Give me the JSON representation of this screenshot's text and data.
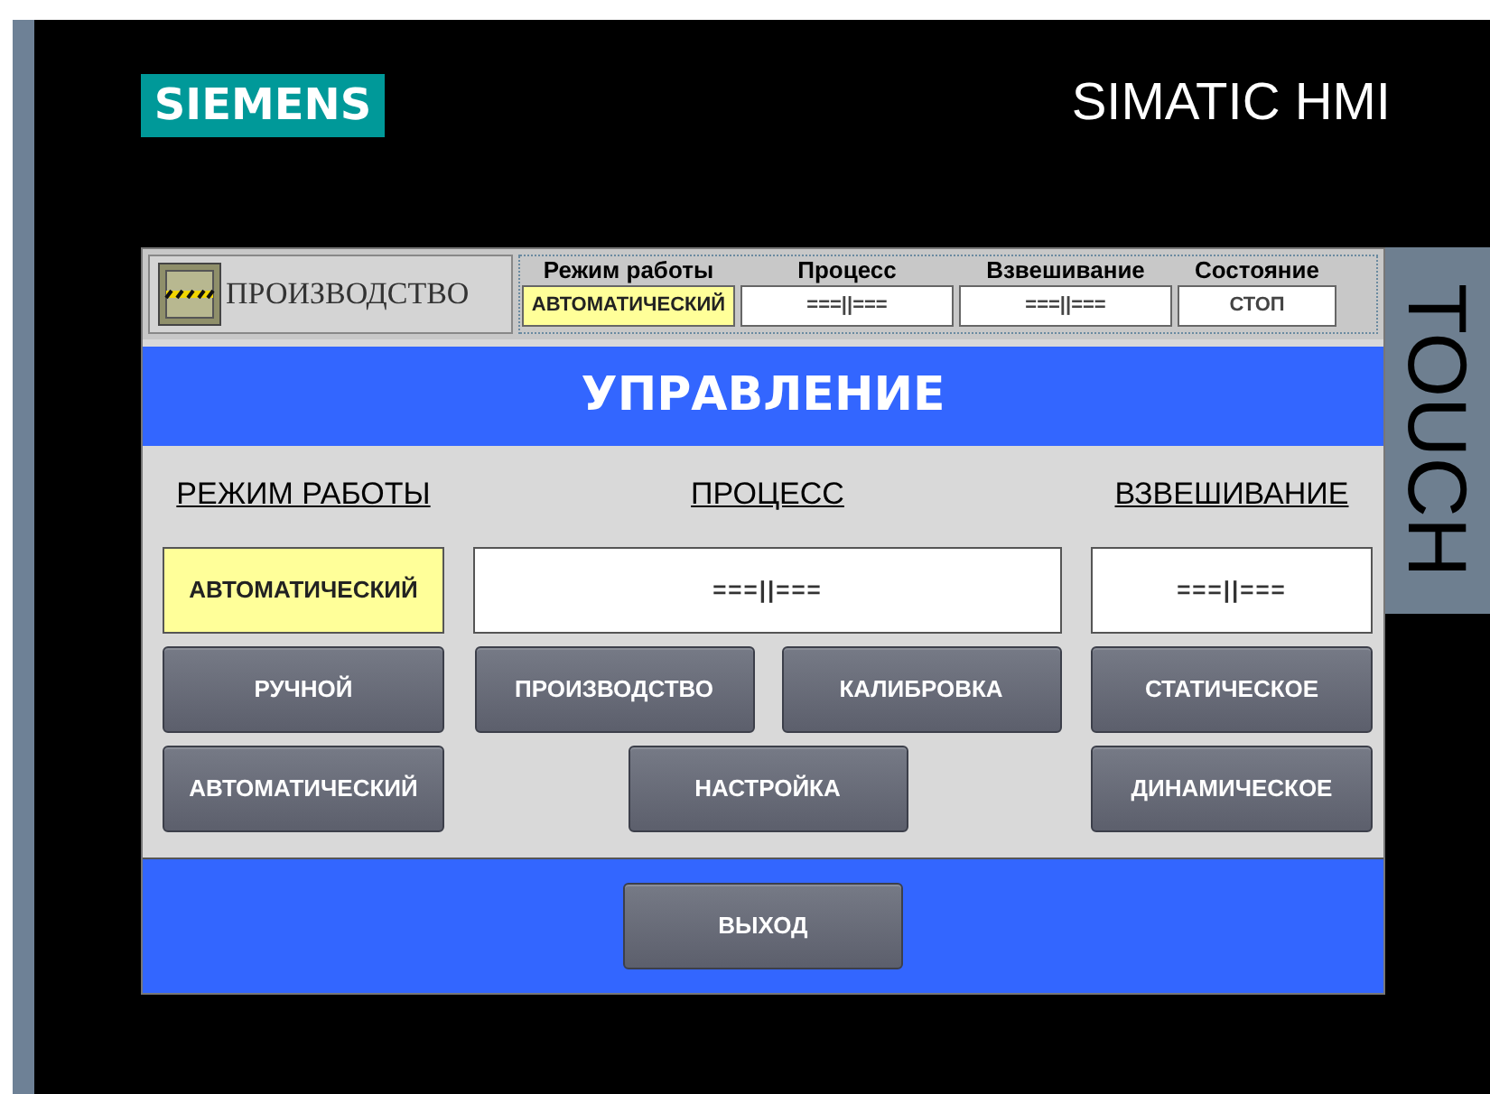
{
  "device": {
    "brand": "SIEMENS",
    "product": "SIMATIC HMI",
    "edge_label": "TOUCH"
  },
  "header": {
    "screen_name": "ПРОИЗВОДСТВО",
    "status": [
      {
        "label": "Режим работы",
        "value": "АВТОМАТИЧЕСКИЙ",
        "highlighted": true
      },
      {
        "label": "Процесс",
        "value": "===||===",
        "highlighted": false
      },
      {
        "label": "Взвешивание",
        "value": "===||===",
        "highlighted": false
      },
      {
        "label": "Состояние",
        "value": "СТОП",
        "highlighted": false
      }
    ]
  },
  "title": "УПРАВЛЕНИЕ",
  "columns": [
    {
      "heading": "РЕЖИМ РАБОТЫ",
      "display": "АВТОМАТИЧЕСКИЙ",
      "highlighted": true,
      "buttons": [
        "РУЧНОЙ",
        "АВТОМАТИЧЕСКИЙ"
      ]
    },
    {
      "heading": "ПРОЦЕСС",
      "display": "===||===",
      "highlighted": false,
      "buttons": [
        "ПРОИЗВОДСТВО",
        "КАЛИБРОВКА",
        "НАСТРОЙКА"
      ]
    },
    {
      "heading": "ВЗВЕШИВАНИЕ",
      "display": "===||===",
      "highlighted": false,
      "buttons": [
        "СТАТИЧЕСКОЕ",
        "ДИНАМИЧЕСКОЕ"
      ]
    }
  ],
  "footer": {
    "button": "ВЫХОД"
  }
}
